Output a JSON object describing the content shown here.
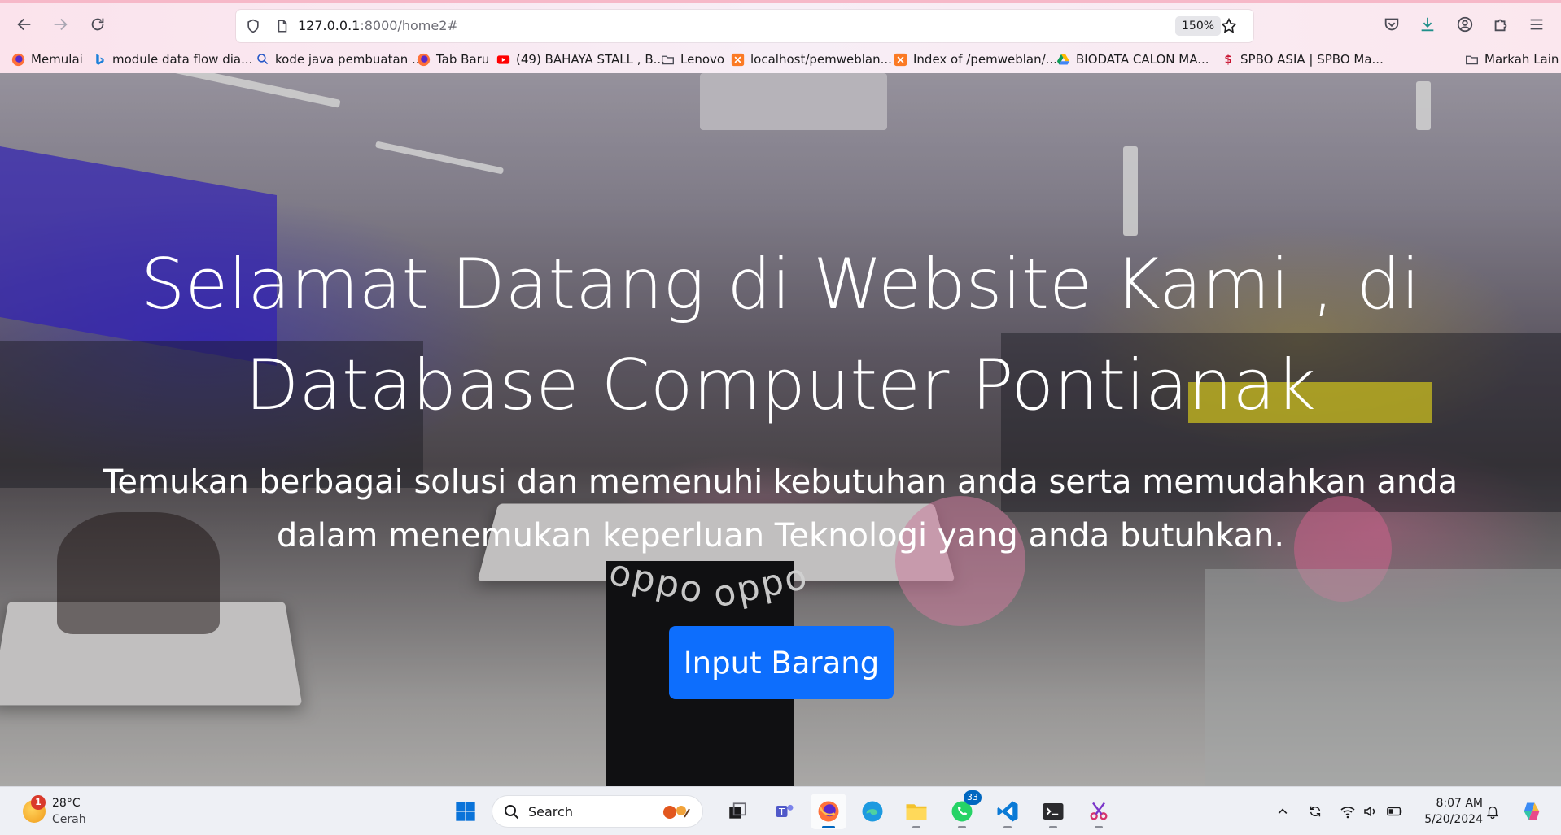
{
  "browser": {
    "url_host": "127.0.0.1",
    "url_rest": ":8000/home2#",
    "zoom": "150%"
  },
  "bookmarks": [
    {
      "label": "Memulai",
      "icon": "firefox-icon"
    },
    {
      "label": "module data flow dia...",
      "icon": "bing-icon"
    },
    {
      "label": "kode java pembuatan ...",
      "icon": "search-icon"
    },
    {
      "label": "Tab Baru",
      "icon": "firefox-icon"
    },
    {
      "label": "(49) BAHAYA STALL , B...",
      "icon": "youtube-icon"
    },
    {
      "label": "Lenovo",
      "icon": "folder-icon"
    },
    {
      "label": "localhost/pemweblan...",
      "icon": "xampp-icon"
    },
    {
      "label": "Index of /pemweblan/...",
      "icon": "xampp-icon"
    },
    {
      "label": "BIODATA CALON MA...",
      "icon": "google-drive-icon"
    },
    {
      "label": "SPBO ASIA | SPBO Ma...",
      "icon": "spbo-icon"
    },
    {
      "label": "Markah Lain",
      "icon": "folder-icon"
    }
  ],
  "hero": {
    "title": "Selamat Datang di Website Kami , di Database Computer Pontianak",
    "subtitle": "Temukan berbagai solusi dan memenuhi kebutuhan anda serta memudahkan anda dalam menemukan keperluan Teknologi yang anda butuhkan.",
    "cta_label": "Input Barang",
    "store_signs": [
      "oppo",
      "oppo"
    ]
  },
  "taskbar": {
    "weather_temp": "28°C",
    "weather_condition": "Cerah",
    "weather_badge": "1",
    "search_label": "Search",
    "whatsapp_badge": "33",
    "time": "8:07 AM",
    "date": "5/20/2024"
  },
  "colors": {
    "cta": "#0d6efd",
    "toolbar": "#f7eef6",
    "taskbar": "#eef0f5"
  }
}
